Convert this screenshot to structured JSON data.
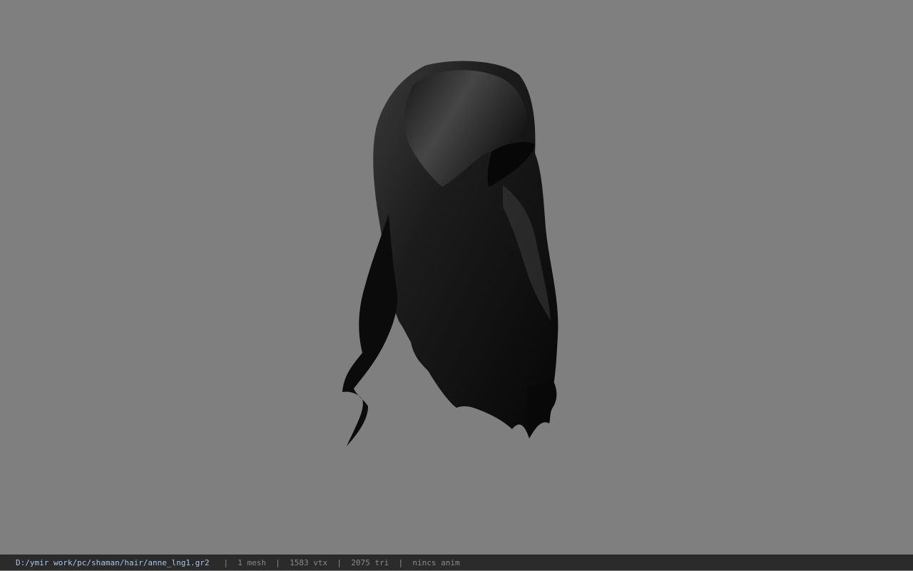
{
  "viewer": {
    "background_color": "#7f7f7f",
    "model": {
      "icon": "hair-mesh-model",
      "color": "#0e0e0e"
    }
  },
  "statusbar": {
    "path": "D:/ymir work/pc/shaman/hair/anne_lng1.gr2",
    "separator": "|",
    "mesh": "1 mesh",
    "vertices": "1583 vtx",
    "triangles": "2075 tri",
    "anim": "nincs anim"
  }
}
